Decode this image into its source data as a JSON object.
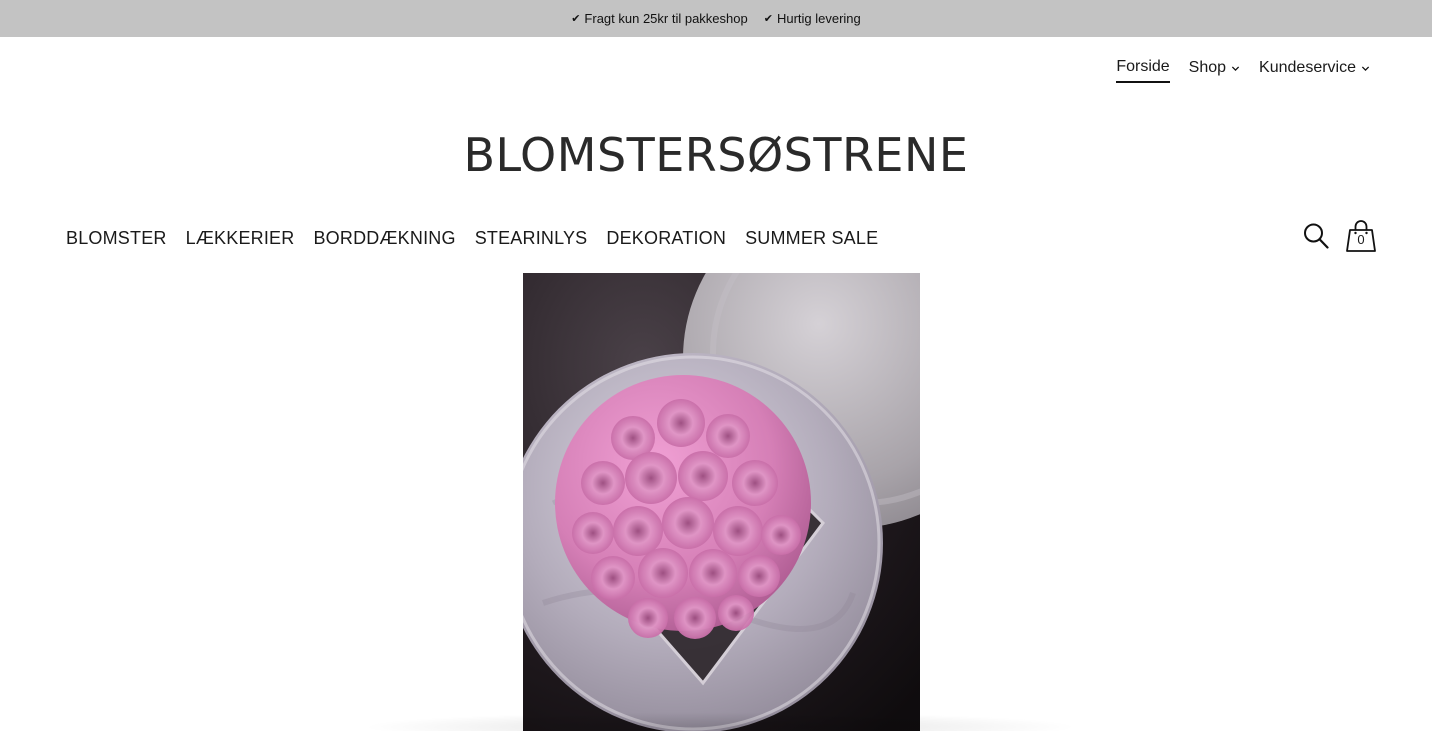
{
  "announcement": {
    "items": [
      "Fragt kun 25kr til pakkeshop",
      "Hurtig levering"
    ],
    "check_glyph": "✔"
  },
  "secondary_nav": {
    "items": [
      {
        "label": "Forside",
        "active": true,
        "has_dropdown": false
      },
      {
        "label": "Shop",
        "active": false,
        "has_dropdown": true
      },
      {
        "label": "Kundeservice",
        "active": false,
        "has_dropdown": true
      }
    ]
  },
  "brand": {
    "name": "BLOMSTERSØSTRENE"
  },
  "main_nav": {
    "items": [
      "BLOMSTER",
      "LÆKKERIER",
      "BORDDÆKNING",
      "STEARINLYS",
      "DEKORATION",
      "SUMMER SALE"
    ]
  },
  "header_icons": {
    "search_icon": "search-icon",
    "cart_icon": "shopping-bag-icon",
    "cart_count": "0"
  },
  "hero": {
    "subject": "pink roses arrangement on marble trays",
    "colors": {
      "rose": "#d77fb8",
      "marble": "#bdb7c6",
      "background": "#1d181c"
    }
  }
}
